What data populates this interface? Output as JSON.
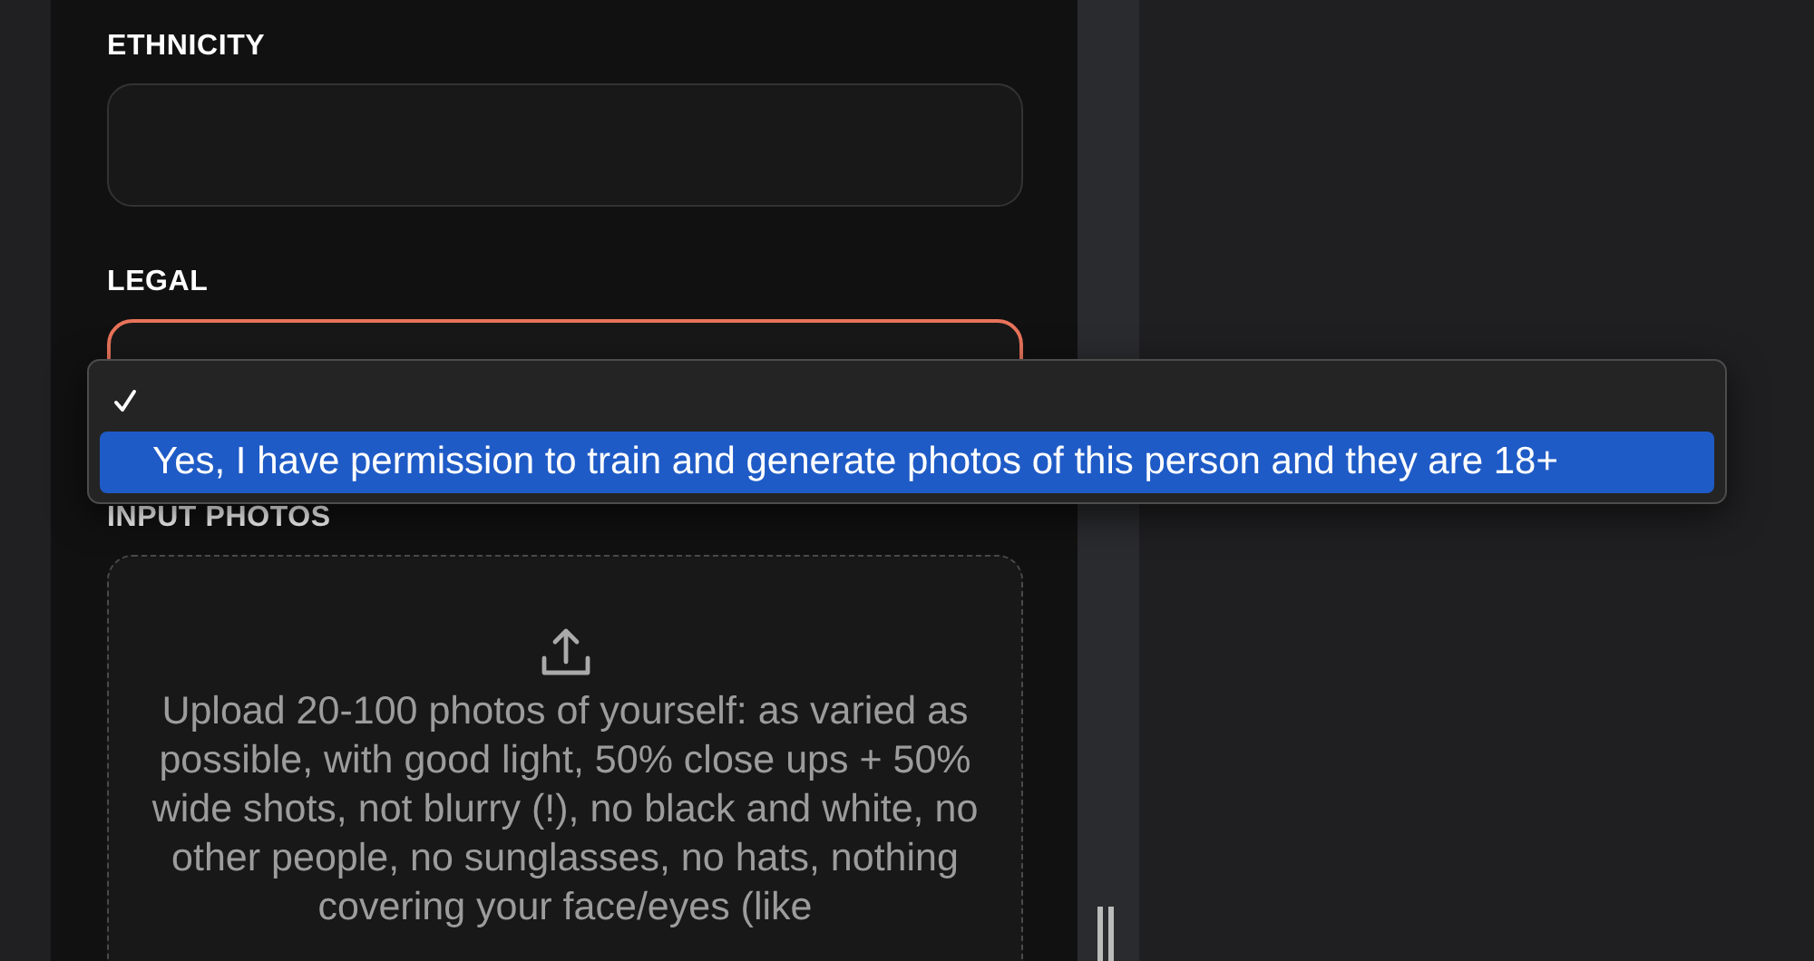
{
  "form": {
    "fields": [
      {
        "kind": "text",
        "label": "ETHNICITY"
      },
      {
        "kind": "select",
        "label": "LEGAL",
        "invalid": true
      },
      {
        "kind": "upload",
        "label": "INPUT PHOTOS",
        "hint": "Upload 20-100 photos of yourself: as varied as possible, with good light, 50% close ups + 50% wide shots, not blurry (!), no black and white, no other people, no sunglasses, no hats, nothing covering your face/eyes (like"
      }
    ]
  },
  "dropdown_menu": {
    "options": [
      {
        "checked": true,
        "selected": false
      },
      {
        "label": "Yes, I have permission to train and generate photos of this person and they are 18+",
        "checked": false,
        "selected": true
      }
    ]
  }
}
